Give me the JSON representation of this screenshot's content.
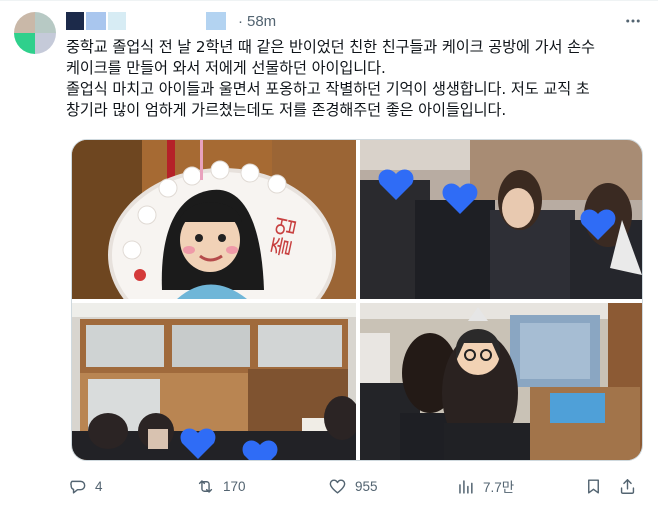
{
  "post": {
    "timestamp": "58m",
    "separator": "·",
    "body": "중학교 졸업식 전 날 2학년 때 같은 반이었던 친한 친구들과 케이크 공방에 가서 손수\n케이크를 만들어 와서 저에게 선물하던 아이입니다.\n졸업식 마치고 아이들과 울면서 포옹하고 작별하던 기억이 생생합니다. 저도 교직 초\n창기라 많이 엄하게 가르쳤는데도 저를 존경해주던 좋은 아이들입니다.",
    "cake_text": "졸업"
  },
  "avatar_colors": [
    "#c9b8a8",
    "#b7c9c4",
    "#2fd08c",
    "#c5cad9"
  ],
  "name_blur_colors": [
    "#1c2a4a",
    "#a9c6ee",
    "#d7ecf4",
    "#cfe5f6",
    "#b3d3f1"
  ],
  "icons": {
    "more": "more-horizontal-icon",
    "reply": "reply-bubble-icon",
    "retweet": "retweet-arrows-icon",
    "like": "heart-icon",
    "views": "bar-chart-icon",
    "bookmark": "bookmark-icon",
    "share": "share-upload-icon"
  },
  "stats": {
    "replies": "4",
    "retweets": "170",
    "likes": "955",
    "views": "7.7만"
  },
  "colors": {
    "text": "#0f1419",
    "secondary": "#536471",
    "border": "#cfd9de",
    "heart_sticker": "#2f6cf6"
  }
}
